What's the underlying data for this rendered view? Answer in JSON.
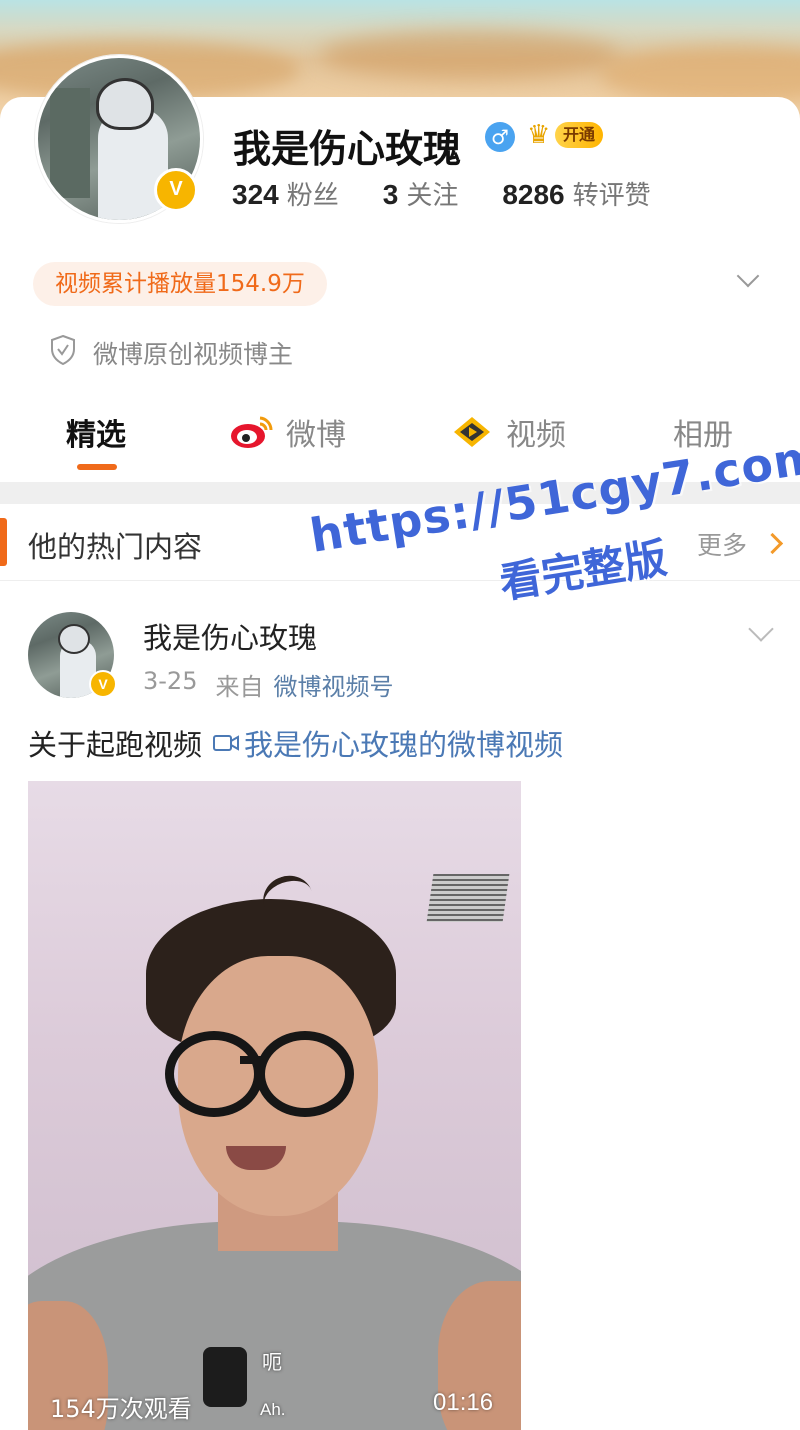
{
  "profile": {
    "name": "我是伤心玫瑰",
    "gender_symbol": "♂",
    "vip_label": "开通",
    "verified_symbol": "V",
    "stats": [
      {
        "value": "324",
        "label": "粉丝"
      },
      {
        "value": "3",
        "label": "关注"
      },
      {
        "value": "8286",
        "label": "转评赞"
      }
    ],
    "play_count": "视频累计播放量154.9万",
    "creator_tag": "微博原创视频博主"
  },
  "tabs": [
    {
      "label": "精选",
      "active": true
    },
    {
      "label": "微博",
      "active": false
    },
    {
      "label": "视频",
      "active": false
    },
    {
      "label": "相册",
      "active": false
    }
  ],
  "hot_section": {
    "title": "他的热门内容",
    "more_label": "更多"
  },
  "post": {
    "author": "我是伤心玫瑰",
    "date": "3-25",
    "from_label": "来自",
    "source": "微博视频号",
    "text": "关于起跑视频",
    "link_text": "我是伤心玫瑰的微博视频",
    "video": {
      "views": "154万次观看",
      "duration": "01:16",
      "subtitle_cn": "呃",
      "subtitle_en": "Ah."
    }
  },
  "watermark": {
    "url": "https://51cgy7.com",
    "text": "看完整版"
  },
  "colors": {
    "accent": "#f06a1a",
    "link": "#4b79b5",
    "watermark": "#3f66d8"
  }
}
